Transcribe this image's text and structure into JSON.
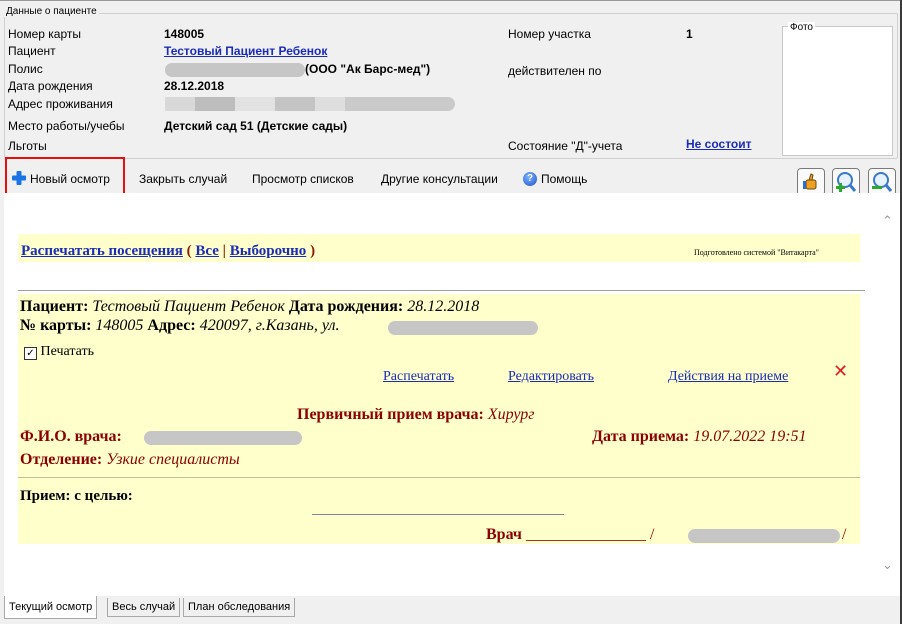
{
  "patient_group": {
    "legend": "Данные о пациенте",
    "card_label": "Номер карты",
    "card_value": "148005",
    "patient_label": "Пациент",
    "patient_value": "Тестовый Пациент Ребенок",
    "policy_label": "Полис",
    "policy_insurer": "(ООО \"Ак Барс-мед\")",
    "dob_label": "Дата рождения",
    "dob_value": "28.12.2018",
    "address_label": "Адрес проживания",
    "work_label": "Место работы/учебы",
    "work_value": "Детский сад 51 (Детские сады)",
    "benefits_label": "Льготы",
    "district_label": "Номер участка",
    "district_value": "1",
    "valid_label": "действителен по",
    "dispensary_label": "Состояние \"Д\"-учета",
    "dispensary_value": "Не состоит",
    "photo_legend": "Фото"
  },
  "toolbar": {
    "new_exam": "Новый осмотр",
    "close_case": "Закрыть случай",
    "view_lists": "Просмотр списков",
    "other_consult": "Другие консультации",
    "help": "Помощь"
  },
  "content": {
    "print_visits": "Распечатать посещения",
    "open_paren": "(",
    "all": "Все",
    "sep": "|",
    "selective": "Выборочно",
    "close_paren": ")",
    "prepared_by": "Подготовлено системой \"Витакарта\"",
    "patient_label": "Пациент:",
    "patient_name": "Тестовый Пациент Ребенок",
    "dob_label": "Дата рождения:",
    "dob": "28.12.2018",
    "card_label": "№ карты:",
    "card": "148005",
    "address_label": "Адрес:",
    "address": "420097, г.Казань, ул.",
    "print_checkbox": "Печатать",
    "print_link": "Распечатать",
    "edit_link": "Редактировать",
    "actions_link": "Действия на приеме",
    "exam_title_prefix": "Первичный прием врача:",
    "exam_specialty": "Хирург",
    "doctor_label": "Ф.И.О. врача:",
    "date_label": "Дата приема:",
    "date_value": "19.07.2022 19:51",
    "department_label": "Отделение:",
    "department_value": "Узкие специалисты",
    "purpose_label": "Прием: с целью:",
    "doctor_sign_label": "Врач",
    "sign_line": "_______________",
    "slash_open": "/",
    "slash_close": "/"
  },
  "tabs": [
    {
      "label": "Текущий осмотр"
    },
    {
      "label": "Весь случай"
    },
    {
      "label": "План обследования"
    }
  ],
  "colors": {
    "link": "#1a2cb8",
    "maroon": "#8b0000",
    "highlight_red": "#e41010",
    "yellow": "#ffffcc"
  }
}
